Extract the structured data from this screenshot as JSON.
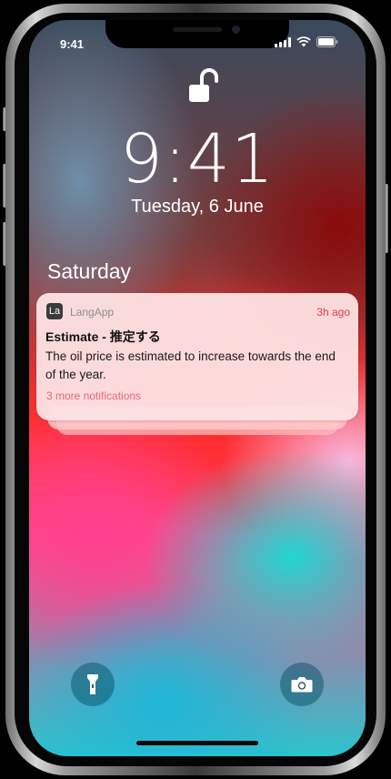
{
  "status_bar": {
    "time": "9:41",
    "signal_icon": "signal-bars-icon",
    "wifi_icon": "wifi-icon",
    "battery_icon": "battery-icon"
  },
  "lock_screen": {
    "lock_icon": "unlocked-padlock-icon",
    "clock": "9:41",
    "date": "Tuesday, 6 June",
    "section_title": "Saturday"
  },
  "notification": {
    "app_icon_text": "La",
    "app_name": "LangApp",
    "time_ago": "3h ago",
    "title": "Estimate - 推定する",
    "body": "The oil price is estimated to increase towards the end of the year.",
    "more": "3 more notifications",
    "accent_color": "#e03c4c"
  },
  "quick_actions": {
    "left_icon": "flashlight-icon",
    "right_icon": "camera-icon"
  }
}
